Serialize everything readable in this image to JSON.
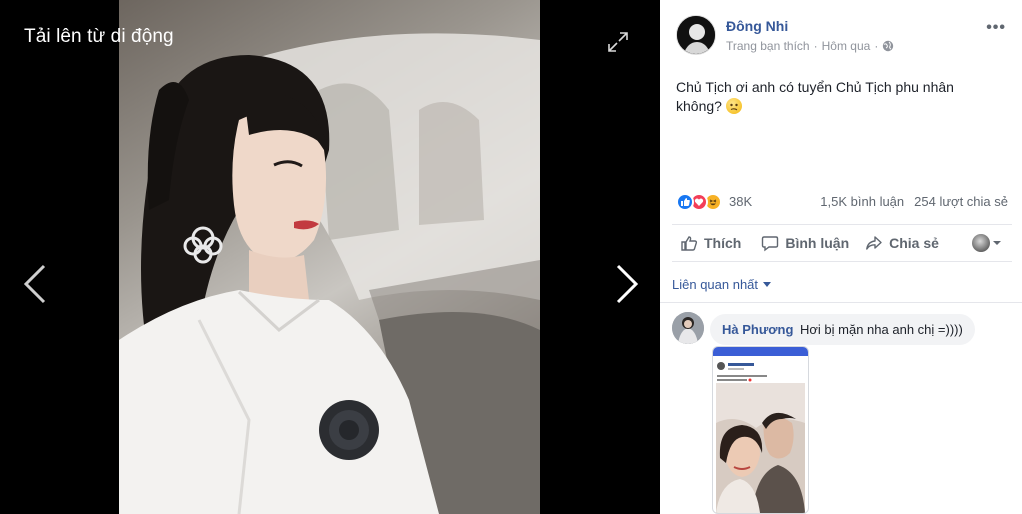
{
  "viewer": {
    "title": "Tải lên từ di động",
    "expand_icon": "expand-arrows-icon",
    "prev_icon": "chevron-left-icon",
    "next_icon": "chevron-right-icon"
  },
  "post": {
    "author": "Đông Nhi",
    "meta_text": "Trang bạn thích",
    "meta_sep": "·",
    "time": "Hôm qua",
    "meta_sep2": "·",
    "audience_icon": "globe-icon",
    "more_label": "•••",
    "text": "Chủ Tịch ơi anh có tuyển Chủ Tịch phu nhân không?",
    "emoji": "confused-face-emoji"
  },
  "stats": {
    "reactions": [
      "like",
      "love",
      "haha"
    ],
    "reaction_count": "38K",
    "comments": "1,5K bình luận",
    "shares": "254 lượt chia sẻ"
  },
  "actions": {
    "like_label": "Thích",
    "comment_label": "Bình luận",
    "share_label": "Chia sẻ"
  },
  "comments_section": {
    "filter_label": "Liên quan nhất",
    "comments": [
      {
        "author": "Hà Phương",
        "text": "Hơi bị mặn nha anh chị =))))"
      }
    ]
  },
  "colors": {
    "link_blue": "#365899",
    "like_blue": "#1877f2",
    "love_red": "#f33e58",
    "haha_yellow": "#f7b125",
    "panel_bg": "#ffffff",
    "viewer_bg": "#000000"
  }
}
